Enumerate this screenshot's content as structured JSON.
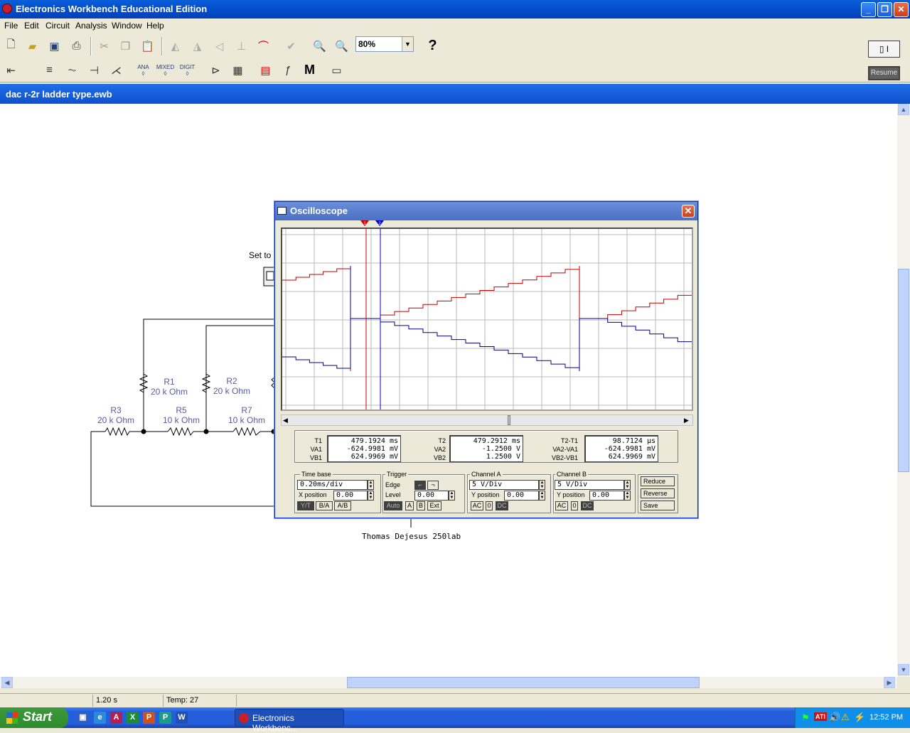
{
  "app": {
    "title": "Electronics Workbench Educational Edition"
  },
  "menu": [
    "File",
    "Edit",
    "Circuit",
    "Analysis",
    "Window",
    "Help"
  ],
  "toolbar": {
    "zoom": "80%",
    "help": "?",
    "resume": "Resume",
    "ana": "ANA",
    "mixed": "MIXED",
    "digit": "DIGIT",
    "m": "M"
  },
  "document": {
    "title": "dac r-2r ladder type.ewb"
  },
  "circuit": {
    "note": "Set to",
    "signature": "Thomas Dejesus 250lab",
    "resistors": [
      {
        "name": "R1",
        "value": "20 k Ohm"
      },
      {
        "name": "R2",
        "value": "20 k Ohm"
      },
      {
        "name": "R3",
        "value": "20 k Ohm"
      },
      {
        "name": "R5",
        "value": "10 k Ohm"
      },
      {
        "name": "R7",
        "value": "10 k Ohm"
      }
    ]
  },
  "oscilloscope": {
    "title": "Oscilloscope",
    "cursors": [
      "1",
      "2"
    ],
    "readout1": {
      "labels": [
        "T1",
        "VA1",
        "VB1"
      ],
      "values": [
        "479.1924 ms",
        "-624.9981 mV",
        "624.9969 mV"
      ]
    },
    "readout2": {
      "labels": [
        "T2",
        "VA2",
        "VB2"
      ],
      "values": [
        "479.2912 ms",
        "-1.2500 V",
        "1.2500 V"
      ]
    },
    "readout3": {
      "labels": [
        "T2-T1",
        "VA2-VA1",
        "VB2-VB1"
      ],
      "values": [
        "98.7124 µs",
        "-624.9981 mV",
        "624.9969 mV"
      ]
    },
    "timebase": {
      "title": "Time base",
      "value": "0.20ms/div",
      "xpos_label": "X position",
      "xpos": "0.00",
      "modes": [
        "Y/T",
        "B/A",
        "A/B"
      ]
    },
    "trigger": {
      "title": "Trigger",
      "edge_label": "Edge",
      "level_label": "Level",
      "level": "0.00",
      "sources": [
        "Auto",
        "A",
        "B",
        "Ext"
      ]
    },
    "channelA": {
      "title": "Channel A",
      "value": "5 V/Div",
      "ypos_label": "Y position",
      "ypos": "0.00",
      "coupling": [
        "AC",
        "0",
        "DC"
      ]
    },
    "channelB": {
      "title": "Channel B",
      "value": "5 V/Div",
      "ypos_label": "Y position",
      "ypos": "0.00",
      "coupling": [
        "AC",
        "0",
        "DC"
      ]
    },
    "buttons": [
      "Reduce",
      "Reverse",
      "Save"
    ],
    "trace_colors": {
      "a": "#c00000",
      "b": "#00008b",
      "cursor1": "#d00000",
      "cursor2": "#0000c0"
    }
  },
  "status": {
    "time": "1.20 s",
    "temp": "Temp: 27"
  },
  "taskbar": {
    "start": "Start",
    "task": "Electronics Workbenc...",
    "clock": "12:52 PM"
  }
}
